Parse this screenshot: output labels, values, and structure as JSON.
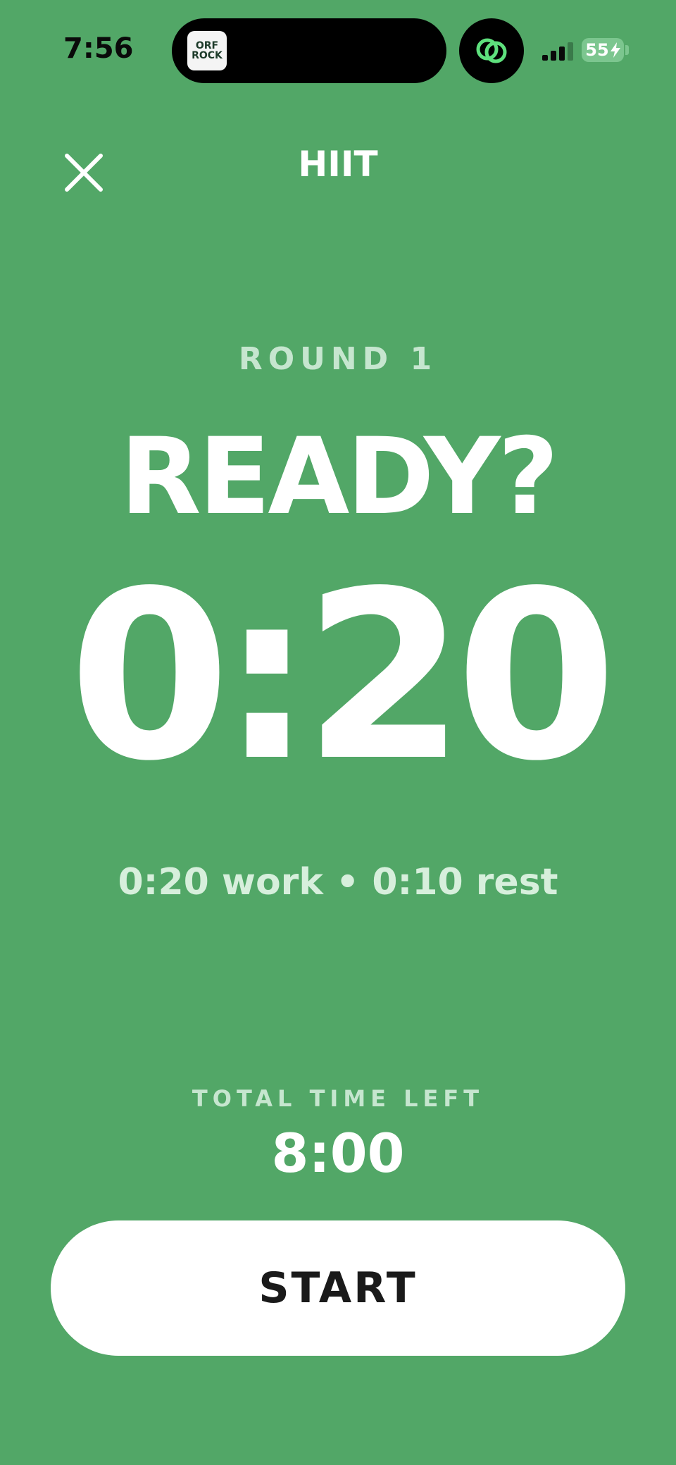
{
  "status_bar": {
    "time": "7:56",
    "now_playing_art_line1": "ORF",
    "now_playing_art_line2": "ROCK",
    "battery_level": "55",
    "link_icon": "linked-circles-icon",
    "signal_icon": "cellular-signal-icon",
    "charging_icon": "bolt-icon"
  },
  "nav": {
    "title": "HIIT",
    "close_icon": "close-icon"
  },
  "timer": {
    "round_label": "ROUND 1",
    "state_label": "READY?",
    "countdown": "0:20",
    "interval_summary": "0:20 work • 0:10 rest",
    "total_label": "TOTAL TIME LEFT",
    "total_value": "8:00"
  },
  "actions": {
    "start_label": "START"
  },
  "colors": {
    "background": "#52a767",
    "accent_green": "#5ee07d",
    "text_primary": "#ffffff",
    "text_muted": "#c6e6cf",
    "button_bg": "#ffffff",
    "button_text": "#1a1a1a"
  }
}
